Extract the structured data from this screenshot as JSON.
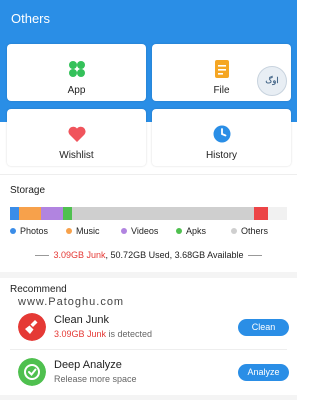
{
  "header": {
    "title": "Others"
  },
  "tiles": [
    {
      "label": "App",
      "icon": "app-grid-icon",
      "color": "#34c15a"
    },
    {
      "label": "File",
      "icon": "file-icon",
      "color": "#f5a623"
    },
    {
      "label": "Wishlist",
      "icon": "heart-icon",
      "color": "#f0545c"
    },
    {
      "label": "History",
      "icon": "clock-icon",
      "color": "#2a8ee6"
    }
  ],
  "watermark": {
    "badge_text": "اوگ",
    "site": "www.Patoghu.com"
  },
  "storage": {
    "title": "Storage",
    "legend": [
      {
        "label": "Photos",
        "color": "#3b8de8"
      },
      {
        "label": "Music",
        "color": "#f7a14b"
      },
      {
        "label": "Videos",
        "color": "#b184e0"
      },
      {
        "label": "Apks",
        "color": "#4fc04f"
      },
      {
        "label": "Others",
        "color": "#cfcfcf"
      }
    ],
    "junk_text": "3.09GB Junk",
    "summary_rest": ", 50.72GB Used, 3.68GB Available",
    "junk_color": "#e53935"
  },
  "recommend": {
    "title": "Recommend",
    "items": [
      {
        "title": "Clean Junk",
        "sub_junk": "3.09GB Junk",
        "sub_rest": " is detected",
        "button": "Clean",
        "icon": "broom-icon",
        "icon_color": "#e53935"
      },
      {
        "title": "Deep Analyze",
        "sub_rest": "Release more space",
        "button": "Analyze",
        "icon": "analyze-icon",
        "icon_color": "#4fc04f"
      }
    ]
  }
}
